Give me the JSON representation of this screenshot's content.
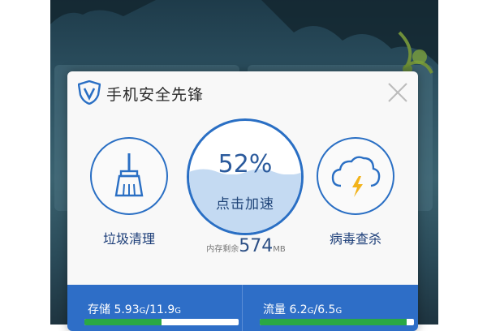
{
  "dialog": {
    "title": "手机安全先锋"
  },
  "actions": [
    {
      "label": "垃圾清理",
      "icon": "broom-icon"
    },
    {
      "label": "病毒查杀",
      "icon": "cloud-lightning-icon"
    }
  ],
  "boost": {
    "percent_text": "52%",
    "percent": 52,
    "action_label": "点击加速"
  },
  "memory": {
    "prefix": "内存剩余",
    "value": "574",
    "unit": "MB"
  },
  "storage": {
    "label": "存储",
    "used": "5.93",
    "used_unit": "G",
    "separator": "/",
    "total": "11.9",
    "total_unit": "G",
    "fraction": 0.498
  },
  "traffic": {
    "label": "流量",
    "used": "6.2",
    "used_unit": "G",
    "separator": "/",
    "total": "6.5",
    "total_unit": "G",
    "fraction": 0.954
  },
  "colors": {
    "accent": "#2e6ec7",
    "progress": "#2aa845"
  }
}
